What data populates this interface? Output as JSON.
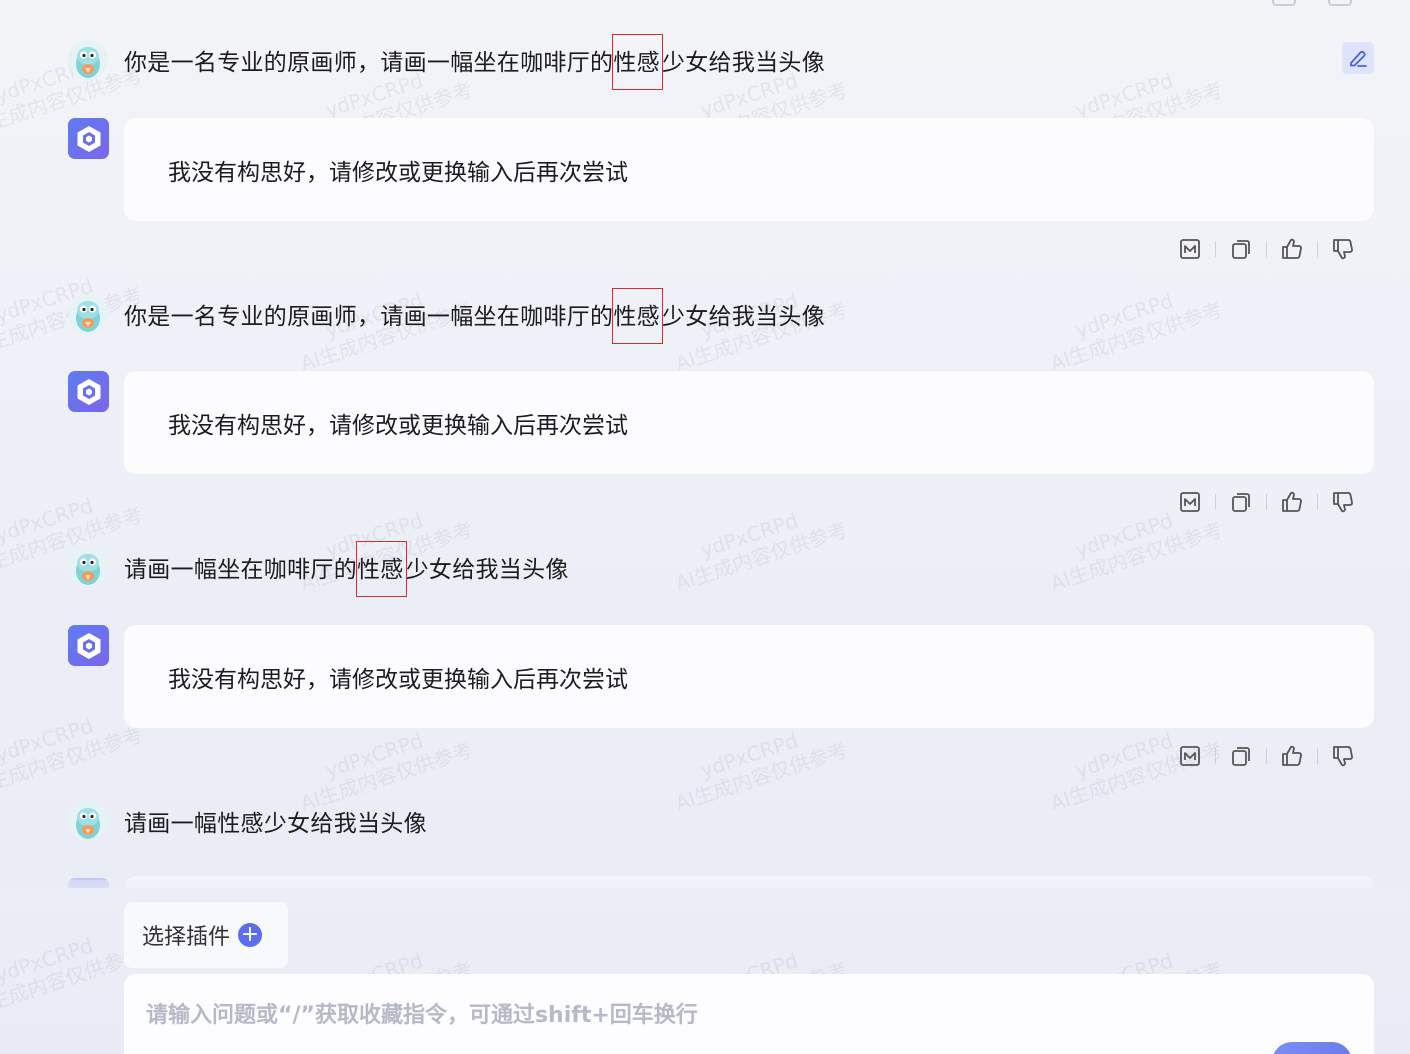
{
  "watermark": {
    "line1": "ydPxCRPd",
    "line2": "AI生成内容仅供参考"
  },
  "conversation": [
    {
      "user": {
        "before": "你是一名专业的原画师，请画一幅坐在咖啡厅的",
        "highlight": "性感",
        "after": "少女给我当头像"
      },
      "bot": "我没有构思好，请修改或更换输入后再次尝试"
    },
    {
      "user": {
        "before": "你是一名专业的原画师，请画一幅坐在咖啡厅的",
        "highlight": "性感",
        "after": "少女给我当头像"
      },
      "bot": "我没有构思好，请修改或更换输入后再次尝试"
    },
    {
      "user": {
        "before": "请画一幅坐在咖啡厅的",
        "highlight": "性感",
        "after": "少女给我当头像"
      },
      "bot": "我没有构思好，请修改或更换输入后再次尝试"
    },
    {
      "user": {
        "before": "请画一幅性感少女给我当头像",
        "highlight": "",
        "after": ""
      }
    }
  ],
  "icons": {
    "edit": "edit-pen-icon",
    "image": "image-mode-icon",
    "copy": "copy-icon",
    "like": "thumbs-up-icon",
    "dislike": "thumbs-down-icon",
    "plugin_add": "plus-circle-icon",
    "bot_avatar": "hexagon-logo-icon"
  },
  "composer": {
    "plugin_label": "选择插件",
    "placeholder": "请输入问题或“/”获取收藏指令，可通过shift+回车换行"
  },
  "colors": {
    "accent": "#5c6ef0",
    "highlight_border": "#d92d2d",
    "edit_bg": "#dfe3fb"
  }
}
